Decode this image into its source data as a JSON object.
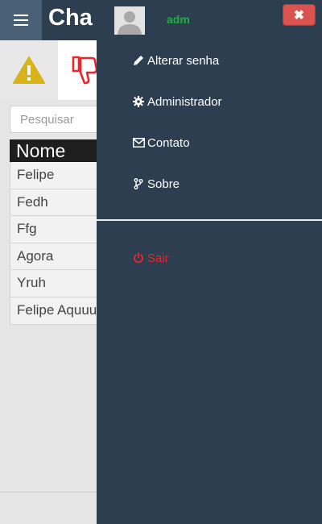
{
  "header": {
    "title_visible": "Cha"
  },
  "search": {
    "placeholder": "Pesquisar"
  },
  "table": {
    "header": "Nome",
    "rows": [
      "Felipe",
      "Fedh",
      "Ffg",
      "Agora",
      "Yruh",
      "Felipe Aquuu"
    ]
  },
  "drawer": {
    "username": "adm",
    "close_label": "✖",
    "items": [
      {
        "label": "Alterar senha",
        "icon": "pencil-icon"
      },
      {
        "label": "Administrador",
        "icon": "gear-icon"
      },
      {
        "label": "Contato",
        "icon": "envelope-icon"
      },
      {
        "label": "Sobre",
        "icon": "branch-icon"
      }
    ],
    "logout_label": "Sair",
    "logout_icon": "power-icon"
  },
  "colors": {
    "topbar": "#2c3e50",
    "drawer": "#2c3e50",
    "username": "#1fb141",
    "close_button": "#d9534f",
    "logout": "#e8262b",
    "warning_icon": "#d9b31b",
    "thumb_icon": "#e8262b"
  }
}
